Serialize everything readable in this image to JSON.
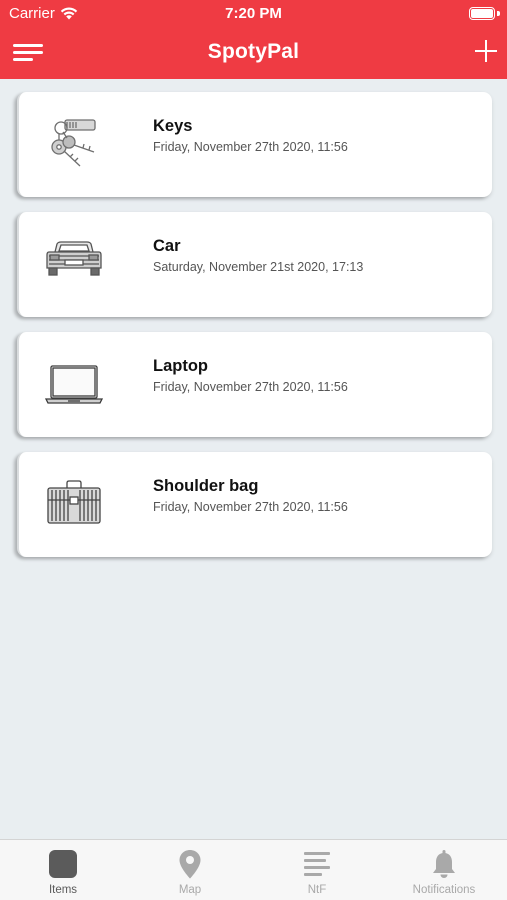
{
  "status_bar": {
    "carrier": "Carrier",
    "time": "7:20 PM"
  },
  "nav": {
    "title": "SpotyPal",
    "menu_icon": "hamburger-menu-icon",
    "add_icon": "plus-icon"
  },
  "items": [
    {
      "title": "Keys",
      "date": "Friday, November 27th 2020, 11:56",
      "icon": "keys-icon"
    },
    {
      "title": "Car",
      "date": "Saturday, November 21st 2020, 17:13",
      "icon": "car-icon"
    },
    {
      "title": "Laptop",
      "date": "Friday, November 27th 2020, 11:56",
      "icon": "laptop-icon"
    },
    {
      "title": "Shoulder bag",
      "date": "Friday, November 27th 2020, 11:56",
      "icon": "briefcase-icon"
    }
  ],
  "tabs": [
    {
      "label": "Items",
      "icon": "items-square-icon",
      "active": true
    },
    {
      "label": "Map",
      "icon": "map-pin-icon",
      "active": false
    },
    {
      "label": "NtF",
      "icon": "lines-icon",
      "active": false
    },
    {
      "label": "Notifications",
      "icon": "bell-icon",
      "active": false
    }
  ],
  "colors": {
    "header": "#ef3b43",
    "background": "#e9eef1",
    "card": "#ffffff",
    "tab_active": "#5b5b5b",
    "tab_inactive": "#a9a9a9"
  }
}
